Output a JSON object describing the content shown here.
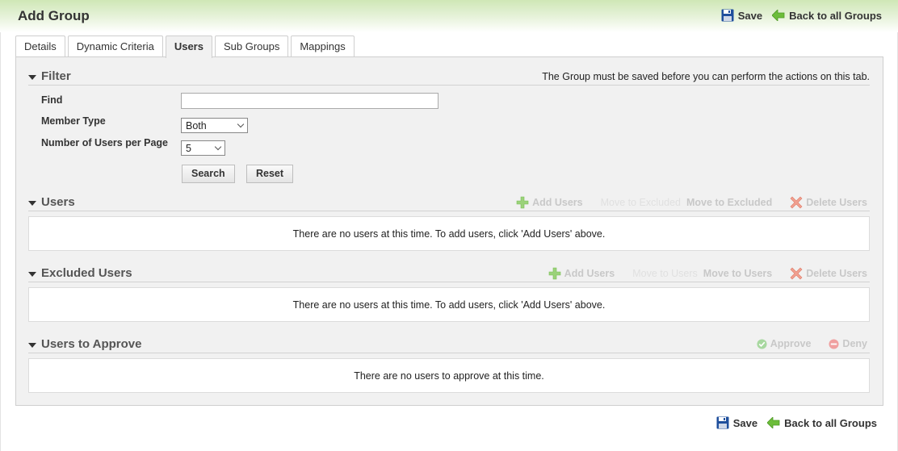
{
  "header": {
    "title": "Add Group",
    "save_label": "Save",
    "back_label": "Back to all Groups"
  },
  "tabs": [
    {
      "label": "Details"
    },
    {
      "label": "Dynamic Criteria"
    },
    {
      "label": "Users",
      "active": true
    },
    {
      "label": "Sub Groups"
    },
    {
      "label": "Mappings"
    }
  ],
  "filter": {
    "title": "Filter",
    "notice": "The Group must be saved before you can perform the actions on this tab.",
    "find_label": "Find",
    "find_value": "",
    "member_type_label": "Member Type",
    "member_type_value": "Both",
    "per_page_label": "Number of Users per Page",
    "per_page_value": "5",
    "search_label": "Search",
    "reset_label": "Reset"
  },
  "users": {
    "title": "Users",
    "add_label": "Add Users",
    "move_ghost": "Move to Excluded",
    "move_label": "Move to Excluded",
    "delete_label": "Delete Users",
    "empty_text": "There are no users at this time. To add users, click 'Add Users' above."
  },
  "excluded": {
    "title": "Excluded Users",
    "add_label": "Add Users",
    "move_ghost": "Move to Users",
    "move_label": "Move to Users",
    "delete_label": "Delete Users",
    "empty_text": "There are no users at this time. To add users, click 'Add Users' above."
  },
  "approve": {
    "title": "Users to Approve",
    "approve_label": "Approve",
    "deny_label": "Deny",
    "empty_text": "There are no users to approve at this time."
  },
  "footer": {
    "save_label": "Save",
    "back_label": "Back to all Groups"
  },
  "colors": {
    "header_green": "#cfe7b6",
    "save_icon": "#1f4f9c",
    "back_arrow": "#6cbd3a",
    "add_icon": "#9bd27a",
    "delete_icon": "#f0a090",
    "approve_icon": "#a8d8a0",
    "deny_icon": "#f0a0a0"
  },
  "icons": [
    "floppy-disk-icon",
    "back-arrow-icon",
    "plus-icon",
    "delete-x-icon",
    "check-circle-icon",
    "minus-circle-icon",
    "caret-down-icon",
    "chevron-down-icon"
  ]
}
